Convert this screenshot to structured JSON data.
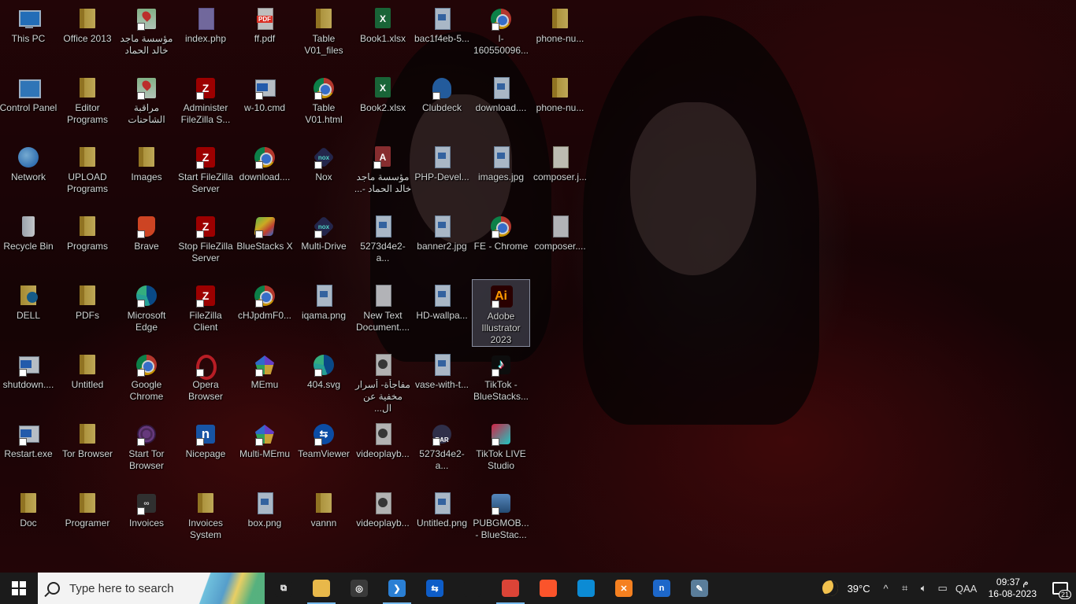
{
  "desktop": {
    "icons": [
      {
        "label": "This PC",
        "type": "pc",
        "col": 0,
        "row": 0
      },
      {
        "label": "Control Panel",
        "type": "cpanel",
        "col": 0,
        "row": 1
      },
      {
        "label": "Network",
        "type": "network",
        "col": 0,
        "row": 2
      },
      {
        "label": "Recycle Bin",
        "type": "bin",
        "col": 0,
        "row": 3
      },
      {
        "label": "DELL",
        "type": "dell",
        "col": 0,
        "row": 4
      },
      {
        "label": "shutdown....",
        "type": "exe",
        "col": 0,
        "row": 5
      },
      {
        "label": "Restart.exe",
        "type": "exe",
        "col": 0,
        "row": 6
      },
      {
        "label": "Doc",
        "type": "folder",
        "col": 0,
        "row": 7
      },
      {
        "label": "Office 2013",
        "type": "folder",
        "col": 1,
        "row": 0
      },
      {
        "label": "Editor Programs",
        "type": "folder",
        "col": 1,
        "row": 1
      },
      {
        "label": "UPLOAD Programs",
        "type": "folder",
        "col": 1,
        "row": 2
      },
      {
        "label": "Programs",
        "type": "folder",
        "col": 1,
        "row": 3
      },
      {
        "label": "PDFs",
        "type": "folder",
        "col": 1,
        "row": 4
      },
      {
        "label": "Untitled",
        "type": "folder",
        "col": 1,
        "row": 5
      },
      {
        "label": "Tor Browser",
        "type": "folder",
        "col": 1,
        "row": 6
      },
      {
        "label": "Programer",
        "type": "folder",
        "col": 1,
        "row": 7
      },
      {
        "label": "مؤسسة ماجد خالد الحماد",
        "type": "map",
        "col": 2,
        "row": 0
      },
      {
        "label": "مراقبة الشاحنات",
        "type": "map",
        "col": 2,
        "row": 1
      },
      {
        "label": "Images",
        "type": "folder",
        "col": 2,
        "row": 2
      },
      {
        "label": "Brave",
        "type": "brave",
        "col": 2,
        "row": 3
      },
      {
        "label": "Microsoft Edge",
        "type": "edge",
        "col": 2,
        "row": 4
      },
      {
        "label": "Google Chrome",
        "type": "chrome",
        "col": 2,
        "row": 5
      },
      {
        "label": "Start Tor Browser",
        "type": "tor",
        "col": 2,
        "row": 6
      },
      {
        "label": "Invoices",
        "type": "invoices",
        "col": 2,
        "row": 7
      },
      {
        "label": "index.php",
        "type": "php",
        "col": 3,
        "row": 0
      },
      {
        "label": "Administer FileZilla S...",
        "type": "filezilla",
        "col": 3,
        "row": 1
      },
      {
        "label": "Start FileZilla Server",
        "type": "filezilla",
        "col": 3,
        "row": 2
      },
      {
        "label": "Stop FileZilla Server",
        "type": "filezilla",
        "col": 3,
        "row": 3
      },
      {
        "label": "FileZilla Client",
        "type": "filezilla",
        "col": 3,
        "row": 4
      },
      {
        "label": "Opera Browser",
        "type": "opera",
        "col": 3,
        "row": 5
      },
      {
        "label": "Nicepage",
        "type": "nicepage",
        "col": 3,
        "row": 6
      },
      {
        "label": "Invoices System",
        "type": "folder",
        "col": 3,
        "row": 7
      },
      {
        "label": "ff.pdf",
        "type": "pdf",
        "col": 4,
        "row": 0
      },
      {
        "label": "w-10.cmd",
        "type": "exe",
        "col": 4,
        "row": 1
      },
      {
        "label": "download....",
        "type": "chrome",
        "col": 4,
        "row": 2
      },
      {
        "label": "BlueStacks X",
        "type": "bluestacks",
        "col": 4,
        "row": 3
      },
      {
        "label": "cHJpdmF0...",
        "type": "chrome",
        "col": 4,
        "row": 4
      },
      {
        "label": "MEmu",
        "type": "memu",
        "col": 4,
        "row": 5
      },
      {
        "label": "Multi-MEmu",
        "type": "memu",
        "col": 4,
        "row": 6
      },
      {
        "label": "box.png",
        "type": "image",
        "col": 4,
        "row": 7
      },
      {
        "label": "Table V01_files",
        "type": "folder",
        "col": 5,
        "row": 0
      },
      {
        "label": "Table V01.html",
        "type": "chrome",
        "col": 5,
        "row": 1
      },
      {
        "label": "Nox",
        "type": "nox",
        "col": 5,
        "row": 2
      },
      {
        "label": "Multi-Drive",
        "type": "nox",
        "col": 5,
        "row": 3
      },
      {
        "label": "iqama.png",
        "type": "image",
        "col": 5,
        "row": 4
      },
      {
        "label": "404.svg",
        "type": "svgedge",
        "col": 5,
        "row": 5
      },
      {
        "label": "TeamViewer",
        "type": "teamviewer",
        "col": 5,
        "row": 6
      },
      {
        "label": "vannn",
        "type": "folder",
        "col": 5,
        "row": 7
      },
      {
        "label": "Book1.xlsx",
        "type": "excel",
        "col": 6,
        "row": 0
      },
      {
        "label": "Book2.xlsx",
        "type": "excel",
        "col": 6,
        "row": 1
      },
      {
        "label": "مؤسسة ماجد خالد الحماد -...",
        "type": "access",
        "col": 6,
        "row": 2
      },
      {
        "label": "5273d4e2-a...",
        "type": "image",
        "col": 6,
        "row": 3
      },
      {
        "label": "New Text Document....",
        "type": "file",
        "col": 6,
        "row": 4
      },
      {
        "label": "مفاجأة- أسرار مخفية عن ال...",
        "type": "video",
        "col": 6,
        "row": 5
      },
      {
        "label": "videoplayb...",
        "type": "video",
        "col": 6,
        "row": 6
      },
      {
        "label": "videoplayb...",
        "type": "video",
        "col": 6,
        "row": 7
      },
      {
        "label": "bac1f4eb-5...",
        "type": "image",
        "col": 7,
        "row": 0
      },
      {
        "label": "Clubdeck",
        "type": "clubdeck",
        "col": 7,
        "row": 1
      },
      {
        "label": "PHP-Devel...",
        "type": "image",
        "col": 7,
        "row": 2
      },
      {
        "label": "banner2.jpg",
        "type": "image",
        "col": 7,
        "row": 3
      },
      {
        "label": "HD-wallpa...",
        "type": "image",
        "col": 7,
        "row": 4
      },
      {
        "label": "vase-with-t...",
        "type": "image",
        "col": 7,
        "row": 5
      },
      {
        "label": "5273d4e2-a...",
        "type": "rar",
        "col": 7,
        "row": 6
      },
      {
        "label": "Untitled.png",
        "type": "image",
        "col": 7,
        "row": 7
      },
      {
        "label": "I-160550096...",
        "type": "chrome",
        "col": 8,
        "row": 0
      },
      {
        "label": "download....",
        "type": "image",
        "col": 8,
        "row": 1
      },
      {
        "label": "images.jpg",
        "type": "image",
        "col": 8,
        "row": 2
      },
      {
        "label": "FE - Chrome",
        "type": "chrome",
        "col": 8,
        "row": 3
      },
      {
        "label": "Adobe Illustrator 2023",
        "type": "ai",
        "col": 8,
        "row": 4,
        "selected": true
      },
      {
        "label": "TikTok - BlueStacks...",
        "type": "tiktok",
        "col": 8,
        "row": 5
      },
      {
        "label": "TikTok LIVE Studio",
        "type": "tiktoklive",
        "col": 8,
        "row": 6
      },
      {
        "label": "PUBGMOB... - BlueStac...",
        "type": "pubg",
        "col": 8,
        "row": 7
      },
      {
        "label": "phone-nu...",
        "type": "folder",
        "col": 9,
        "row": 0
      },
      {
        "label": "phone-nu...",
        "type": "folder",
        "col": 9,
        "row": 1
      },
      {
        "label": "composer.j...",
        "type": "json",
        "col": 9,
        "row": 2
      },
      {
        "label": "composer....",
        "type": "file",
        "col": 9,
        "row": 3
      }
    ]
  },
  "icon_glyph_text": {
    "ai": "Ai",
    "filezilla": "Z",
    "nox": "nox",
    "teamviewer": "⇆",
    "nicepage": "n",
    "rar": "RAR",
    "tiktok": "♪",
    "invoices": "∞",
    "pdf": "PDF",
    "excel": "X",
    "access": "A"
  },
  "taskbar": {
    "search_placeholder": "Type here to search",
    "apps": [
      {
        "name": "task-view",
        "glyph": "⧉",
        "color": "#1b1b1b",
        "active": false
      },
      {
        "name": "file-explorer",
        "glyph": "",
        "color": "#e8b84a",
        "active": true
      },
      {
        "name": "obs",
        "glyph": "◎",
        "color": "#3a3a3a",
        "active": false
      },
      {
        "name": "vscode",
        "glyph": "❯",
        "color": "#2a7fd4",
        "active": true
      },
      {
        "name": "teamviewer",
        "glyph": "⇆",
        "color": "#0e5dc8",
        "active": false
      },
      {
        "name": "blank",
        "glyph": "",
        "color": "#1b1b1b",
        "active": false
      },
      {
        "name": "chrome-fe",
        "glyph": "",
        "color": "#db4437",
        "active": true
      },
      {
        "name": "brave",
        "glyph": "",
        "color": "#fb542b",
        "active": false
      },
      {
        "name": "edge",
        "glyph": "",
        "color": "#0c8bd4",
        "active": false
      },
      {
        "name": "xampp",
        "glyph": "✕",
        "color": "#f58020",
        "active": false
      },
      {
        "name": "nicepage",
        "glyph": "n",
        "color": "#1d67c9",
        "active": false
      },
      {
        "name": "paint",
        "glyph": "✎",
        "color": "#5a7d9a",
        "active": false
      }
    ],
    "weather": {
      "temp": "39°C"
    },
    "tray": {
      "chevron": "^",
      "language": "QAA"
    },
    "clock": {
      "time": "09:37 م",
      "date": "16-08-2023"
    },
    "notifications": {
      "count": "21"
    }
  }
}
